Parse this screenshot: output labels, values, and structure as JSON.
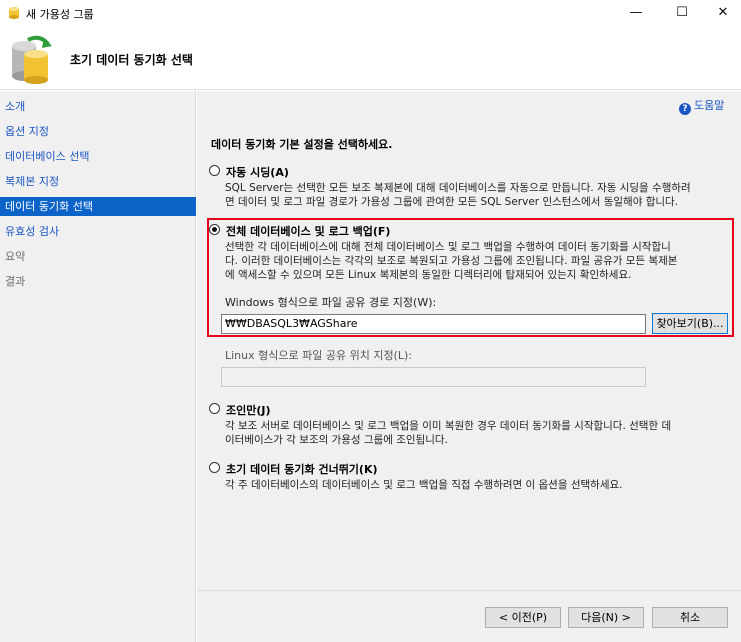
{
  "window": {
    "title": "새 가용성 그룹",
    "minimize_glyph": "—",
    "maximize_glyph": "☐",
    "close_glyph": "✕"
  },
  "header": {
    "title": "초기 데이터 동기화 선택",
    "icon": "database-sync-icon"
  },
  "nav": {
    "items": [
      {
        "label": "소개",
        "state": "link"
      },
      {
        "label": "옵션 지정",
        "state": "link"
      },
      {
        "label": "데이터베이스 선택",
        "state": "link"
      },
      {
        "label": "복제본 지정",
        "state": "link"
      },
      {
        "label": "데이터 동기화 선택",
        "state": "active"
      },
      {
        "label": "유효성 검사",
        "state": "link"
      },
      {
        "label": "요약",
        "state": "disabled"
      },
      {
        "label": "결과",
        "state": "disabled"
      }
    ]
  },
  "main": {
    "help_label": "도움말",
    "heading": "데이터 동기화 기본 설정을 선택하세요.",
    "options": {
      "automatic": {
        "label": "자동 시딩(A)",
        "desc1": "SQL Server는 선택한 모든 보조 복제본에 대해 데이터베이스를 자동으로 만듭니다. 자동 시딩을 수행하려",
        "desc2": "면 데이터 및 로그 파일 경로가 가용성 그룹에 관여한 모든 SQL Server 인스턴스에서 동일해야 합니다."
      },
      "full": {
        "label": "전체 데이터베이스 및 로그 백업(F)",
        "desc1": "선택한 각 데이터베이스에 대해 전체 데이터베이스 및 로그 백업을 수행하여 데이터 동기화를 시작합니",
        "desc2": "다. 이러한 데이터베이스는 각각의 보조로 복원되고 가용성 그룹에 조인됩니다. 파일 공유가 모든 복제본",
        "desc3": "에 액세스할 수 있으며 모든 Linux 복제본의 동일한 디렉터리에 탑재되어 있는지 확인하세요.",
        "windows_path_label": "Windows 형식으로 파일 공유 경로 지정(W):",
        "windows_path_value": "₩₩DBASQL3₩AGShare",
        "browse_label": "찾아보기(B)...",
        "linux_path_label": "Linux 형식으로 파일 공유 위치 지정(L):",
        "linux_path_value": ""
      },
      "join_only": {
        "label": "조인만(J)",
        "desc1": "각 보조 서버로 데이터베이스 및 로그 백업을 이미 복원한 경우 데이터 동기화를 시작합니다. 선택한 데",
        "desc2": "이터베이스가 각 보조의 가용성 그룹에 조인됩니다."
      },
      "skip": {
        "label": "초기 데이터 동기화 건너뛰기(K)",
        "desc1": "각 주 데이터베이스의 데이터베이스 및 로그 백업을 직접 수행하려면 이 옵션을 선택하세요."
      }
    },
    "selected_option": "full"
  },
  "footer": {
    "prev_label": "< 이전(P)",
    "next_label": "다음(N) >",
    "cancel_label": "취소"
  },
  "colors": {
    "accent": "#0c64c9",
    "link": "#1a56c4",
    "highlight_border": "#e3001b"
  }
}
